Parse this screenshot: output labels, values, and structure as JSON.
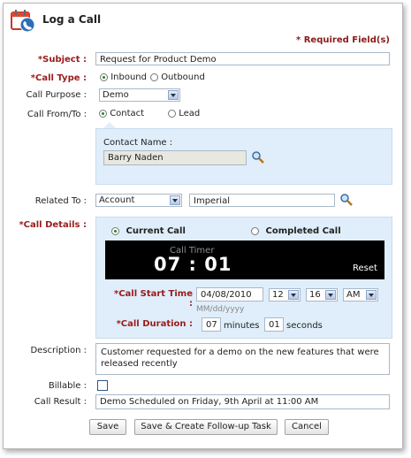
{
  "window": {
    "title": "Log a Call",
    "required_note": "* Required Field(s)"
  },
  "subject": {
    "label": "*Subject :",
    "value": "Request for Product Demo"
  },
  "call_type": {
    "label": "*Call Type :",
    "options": [
      "Inbound",
      "Outbound"
    ],
    "selected": "Inbound"
  },
  "call_purpose": {
    "label": "Call Purpose :",
    "value": "Demo"
  },
  "call_from_to": {
    "label": "Call From/To :",
    "options": [
      "Contact",
      "Lead"
    ],
    "selected": "Contact"
  },
  "contact": {
    "label": "Contact Name :",
    "value": "Barry Naden"
  },
  "related_to": {
    "label": "Related To :",
    "type": "Account",
    "value": "Imperial"
  },
  "call_details": {
    "label": "*Call Details :",
    "options": [
      "Current Call",
      "Completed Call"
    ],
    "selected": "Current Call",
    "timer_label": "Call Timer",
    "timer_value": "07 : 01",
    "reset_label": "Reset",
    "start_time_label": "*Call Start Time :",
    "start_date": "04/08/2010",
    "date_format": "MM/dd/yyyy",
    "hour": "12",
    "minute": "16",
    "ampm": "AM",
    "duration_label": "*Call Duration :",
    "duration_minutes": "07",
    "minutes_label": "minutes",
    "duration_seconds": "01",
    "seconds_label": "seconds"
  },
  "description": {
    "label": "Description :",
    "value": "Customer requested for a demo on the new features that were released  recently"
  },
  "billable": {
    "label": "Billable :",
    "checked": false
  },
  "call_result": {
    "label": "Call Result :",
    "value": "Demo Scheduled on Friday, 9th April at 11:00 AM"
  },
  "buttons": {
    "save": "Save",
    "save_followup": "Save & Create Follow-up Task",
    "cancel": "Cancel"
  },
  "colors": {
    "required": "#9a1b1b",
    "panel_bg": "#dfeefa",
    "timer_bg": "#000000",
    "radio_dot": "#1a8a1a"
  }
}
